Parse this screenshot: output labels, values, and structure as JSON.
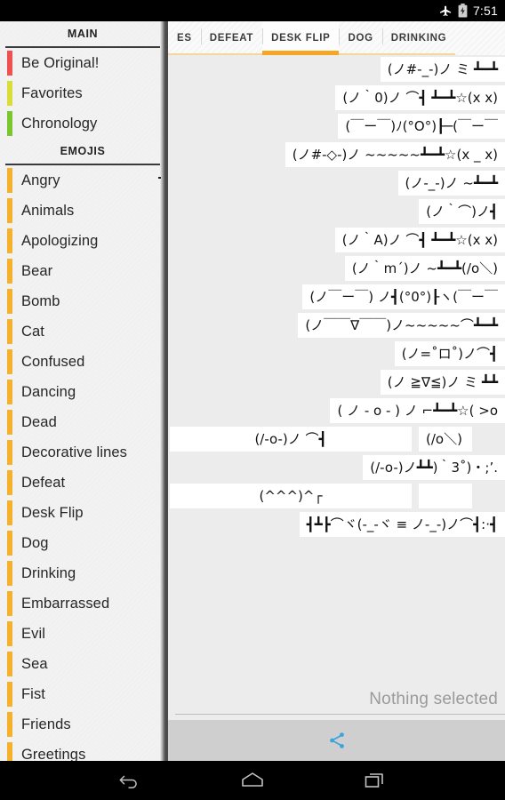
{
  "statusbar": {
    "time": "7:51",
    "icons": [
      "airplane-mode-icon",
      "battery-charging-icon"
    ]
  },
  "drawer": {
    "sections": [
      {
        "header": "MAIN",
        "items": [
          {
            "label": "Be Original!",
            "color": "#f0504f"
          },
          {
            "label": "Favorites",
            "color": "#d9dd38"
          },
          {
            "label": "Chronology",
            "color": "#7bc72e"
          }
        ]
      },
      {
        "header": "EMOJIS",
        "items": [
          {
            "label": "Angry",
            "color": "#f6b12c"
          },
          {
            "label": "Animals",
            "color": "#f6b12c"
          },
          {
            "label": "Apologizing",
            "color": "#f6b12c"
          },
          {
            "label": "Bear",
            "color": "#f6b12c"
          },
          {
            "label": "Bomb",
            "color": "#f6b12c"
          },
          {
            "label": "Cat",
            "color": "#f6b12c"
          },
          {
            "label": "Confused",
            "color": "#f6b12c"
          },
          {
            "label": "Dancing",
            "color": "#f6b12c"
          },
          {
            "label": "Dead",
            "color": "#f6b12c"
          },
          {
            "label": "Decorative lines",
            "color": "#f6b12c"
          },
          {
            "label": "Defeat",
            "color": "#f6b12c"
          },
          {
            "label": "Desk Flip",
            "color": "#f6b12c"
          },
          {
            "label": "Dog",
            "color": "#f6b12c"
          },
          {
            "label": "Drinking",
            "color": "#f6b12c"
          },
          {
            "label": "Embarrassed",
            "color": "#f6b12c"
          },
          {
            "label": "Evil",
            "color": "#f6b12c"
          },
          {
            "label": "Sea",
            "color": "#f6b12c"
          },
          {
            "label": "Fist",
            "color": "#f6b12c"
          },
          {
            "label": "Friends",
            "color": "#f6b12c"
          },
          {
            "label": "Greetings",
            "color": "#f6b12c"
          }
        ]
      }
    ]
  },
  "main": {
    "tabs": [
      {
        "label": "ES",
        "active": false
      },
      {
        "label": "DEFEAT",
        "active": false
      },
      {
        "label": "DESK FLIP",
        "active": true
      },
      {
        "label": "DOG",
        "active": false
      },
      {
        "label": "DRINKING",
        "active": false
      }
    ],
    "active_tab": "DESK FLIP",
    "accent_color": "#f6a623",
    "emojis": [
      {
        "text": "(ノ#-_-)ノ ミ  ┻━┻"
      },
      {
        "text": "(ノ｀0)ノ ⌒┫ ┻━┻☆(x x)"
      },
      {
        "text": "(￣ー￣)ﾉ(°O°)┠─(￣ー￣"
      },
      {
        "text": "(ノ#-◇-)ノ ~~~~~┻━┻☆(x _ x)"
      },
      {
        "text": "(ノ-_-)ノ ~┻━┻"
      },
      {
        "text": "(ノ｀⌒)ノ┫"
      },
      {
        "text": "(ノ｀A)ノ ⌒┫ ┻━┻☆(x x)"
      },
      {
        "text": "(ノ｀m´)ノ ~┻━┻(/o＼)"
      },
      {
        "text": "(ノ￣ー￣) ノ┫(°0°)┠ヽ(￣ー￣"
      },
      {
        "text": "(ノ￣￣∇￣￣)ノ~~~~~⌒┻━┻"
      },
      {
        "text": "(ノ=˚ロ˚)ノ⌒┫"
      },
      {
        "text": "(ノ ≧∇≦)ノ ミ ┻┻"
      },
      {
        "text": "( ノ - o - ) ノ  ⌐┻━┻☆( >o"
      },
      {
        "text": "(/-o-)ノ ⌒┫",
        "text2": "(/o＼)",
        "split": true
      },
      {
        "text": "(/-o-)ノ┻┻)｀3˚)・;’."
      },
      {
        "text": "(^^^)^┌",
        "text2": "",
        "split": true,
        "leftwide": true
      },
      {
        "text": "┫┻┣⌒ヾ(-_-ヾ ≡ ノ-_-)ノ⌒┫:·┫"
      }
    ],
    "selection_placeholder": "Nothing selected",
    "share_icon": "share-icon",
    "share_icon_color": "#3ba4dd"
  },
  "navbar": {
    "buttons": [
      "back-button",
      "home-button",
      "recents-button"
    ]
  }
}
